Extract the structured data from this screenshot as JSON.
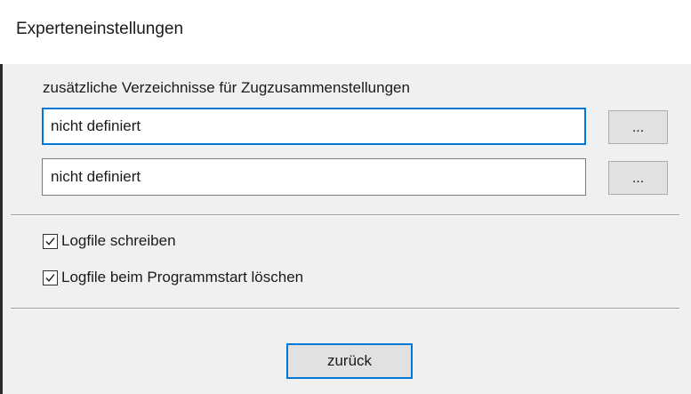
{
  "window": {
    "title": "Experteneinstellungen"
  },
  "directories": {
    "label": "zusätzliche Verzeichnisse für Zugzusammenstellungen",
    "fields": [
      {
        "value": "nicht definiert",
        "browse_label": "..."
      },
      {
        "value": "nicht definiert",
        "browse_label": "..."
      }
    ]
  },
  "options": [
    {
      "label": "Logfile schreiben",
      "checked": true
    },
    {
      "label": "Logfile beim Programmstart löschen",
      "checked": true
    }
  ],
  "footer": {
    "back_label": "zurück"
  },
  "colors": {
    "accent": "#0078d7",
    "button_face": "#e1e1e1",
    "dialog_background": "#f0f0f0"
  }
}
